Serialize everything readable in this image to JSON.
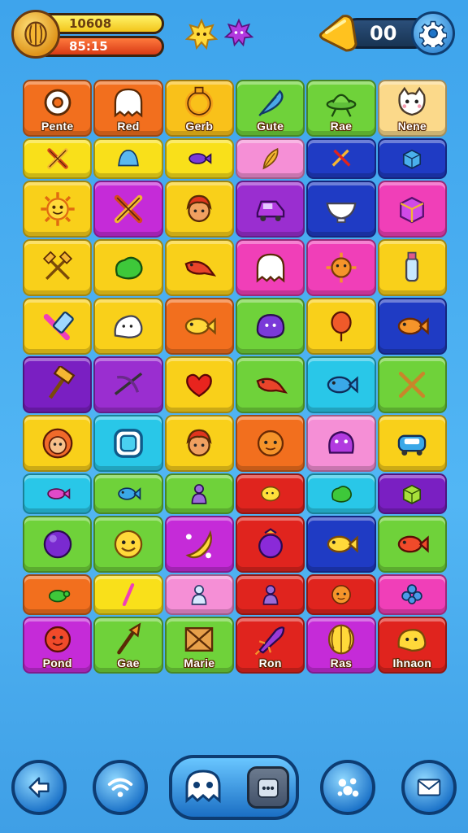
{
  "hud": {
    "score": "10608",
    "timer": "85:15",
    "moves": "00",
    "icons": [
      "coin-icon",
      "yellow-star-icon",
      "purple-star-icon",
      "bell-icon",
      "gear-icon"
    ]
  },
  "board": {
    "rows": [
      {
        "size": "tall",
        "tiles": [
          {
            "color": "#f26f1e",
            "icon": "ring-blob",
            "label": "Pente"
          },
          {
            "color": "#f26f1e",
            "icon": "ghost",
            "label": "Red"
          },
          {
            "color": "#f9c11a",
            "icon": "ring",
            "label": "Gerb"
          },
          {
            "color": "#6fd23a",
            "icon": "leaf-feather",
            "label": "Gute"
          },
          {
            "color": "#6fd23a",
            "icon": "ufo",
            "label": "Rae"
          },
          {
            "color": "#fbd98a",
            "icon": "cat-face",
            "label": "Nene"
          }
        ]
      },
      {
        "size": "short",
        "tiles": [
          {
            "color": "#f9e01a",
            "icon": "cross-tools"
          },
          {
            "color": "#f9e01a",
            "icon": "blue-blob"
          },
          {
            "color": "#f9e01a",
            "icon": "purple-fish"
          },
          {
            "color": "#f58fd6",
            "icon": "feather"
          },
          {
            "color": "#1f3bc4",
            "icon": "crossed-swords"
          },
          {
            "color": "#1f3bc4",
            "icon": "blue-box"
          }
        ]
      },
      {
        "size": "tall",
        "tiles": [
          {
            "color": "#f9d01a",
            "icon": "sun-face"
          },
          {
            "color": "#c52bd8",
            "icon": "cross-tools"
          },
          {
            "color": "#f9d01a",
            "icon": "face-red-hair"
          },
          {
            "color": "#9a2ed0",
            "icon": "purple-car"
          },
          {
            "color": "#1f3bc4",
            "icon": "bowl"
          },
          {
            "color": "#f03fb8",
            "icon": "purple-cube"
          }
        ]
      },
      {
        "size": "tall",
        "tiles": [
          {
            "color": "#f9d01a",
            "icon": "crossed-hammers"
          },
          {
            "color": "#f9d01a",
            "icon": "green-blob"
          },
          {
            "color": "#f9d01a",
            "icon": "red-bird"
          },
          {
            "color": "#f03fb8",
            "icon": "ghost"
          },
          {
            "color": "#f03fb8",
            "icon": "orange-star"
          },
          {
            "color": "#f9d01a",
            "icon": "bottle"
          }
        ]
      },
      {
        "size": "tall",
        "tiles": [
          {
            "color": "#f9d01a",
            "icon": "pink-tool"
          },
          {
            "color": "#f9d01a",
            "icon": "white-blob"
          },
          {
            "color": "#f26f1e",
            "icon": "yellow-fish"
          },
          {
            "color": "#6fd23a",
            "icon": "purple-blob"
          },
          {
            "color": "#f9d01a",
            "icon": "red-balloon"
          },
          {
            "color": "#1f3bc4",
            "icon": "orange-fish"
          }
        ]
      },
      {
        "size": "tall",
        "tiles": [
          {
            "color": "#7a1fc2",
            "icon": "hammer"
          },
          {
            "color": "#9a2ed0",
            "icon": "crossbow"
          },
          {
            "color": "#f9d01a",
            "icon": "heart-fruit"
          },
          {
            "color": "#6fd23a",
            "icon": "red-bird"
          },
          {
            "color": "#29c7e8",
            "icon": "blue-fish"
          },
          {
            "color": "#6fd23a",
            "icon": "crossed-sticks"
          }
        ]
      },
      {
        "size": "tall",
        "tiles": [
          {
            "color": "#f9d01a",
            "icon": "girl-face"
          },
          {
            "color": "#29c7e8",
            "icon": "blue-frame"
          },
          {
            "color": "#f9d01a",
            "icon": "face-red-hair"
          },
          {
            "color": "#f26f1e",
            "icon": "orange-face"
          },
          {
            "color": "#f58fd6",
            "icon": "purple-monster"
          },
          {
            "color": "#f9d01a",
            "icon": "blue-car"
          }
        ]
      },
      {
        "size": "short",
        "tiles": [
          {
            "color": "#29c7e8",
            "icon": "pink-fish"
          },
          {
            "color": "#6fd23a",
            "icon": "blue-fish"
          },
          {
            "color": "#6fd23a",
            "icon": "purple-figure"
          },
          {
            "color": "#e0241e",
            "icon": "yellow-lemon"
          },
          {
            "color": "#29c7e8",
            "icon": "green-blob"
          },
          {
            "color": "#7a1fc2",
            "icon": "green-box"
          }
        ]
      },
      {
        "size": "tall",
        "tiles": [
          {
            "color": "#6fd23a",
            "icon": "purple-ball"
          },
          {
            "color": "#6fd23a",
            "icon": "yellow-face"
          },
          {
            "color": "#c52bd8",
            "icon": "banana"
          },
          {
            "color": "#e0241e",
            "icon": "purple-gem"
          },
          {
            "color": "#1f3bc4",
            "icon": "yellow-fish"
          },
          {
            "color": "#6fd23a",
            "icon": "red-fish"
          }
        ]
      },
      {
        "size": "short",
        "tiles": [
          {
            "color": "#f26f1e",
            "icon": "turtle"
          },
          {
            "color": "#f9e01a",
            "icon": "pink-stick"
          },
          {
            "color": "#f58fd6",
            "icon": "blue-figure"
          },
          {
            "color": "#e0241e",
            "icon": "purple-figure"
          },
          {
            "color": "#e0241e",
            "icon": "orange-face"
          },
          {
            "color": "#f03fb8",
            "icon": "blue-flower"
          }
        ]
      },
      {
        "size": "tall",
        "tiles": [
          {
            "color": "#c52bd8",
            "icon": "red-flower",
            "label": "Pond"
          },
          {
            "color": "#6fd23a",
            "icon": "torch",
            "label": "Gae"
          },
          {
            "color": "#6fd23a",
            "icon": "envelope-box",
            "label": "Marie"
          },
          {
            "color": "#e0241e",
            "icon": "purple-rocket",
            "label": "Ron"
          },
          {
            "color": "#c52bd8",
            "icon": "yellow-ball",
            "label": "Ras"
          },
          {
            "color": "#e0241e",
            "icon": "yellow-blob",
            "label": "Ihnaon"
          }
        ]
      }
    ]
  },
  "nav": {
    "buttons": [
      "back-arrow-icon",
      "wifi-icon",
      "ghost-icon",
      "cards-icon",
      "mail-icon"
    ]
  }
}
